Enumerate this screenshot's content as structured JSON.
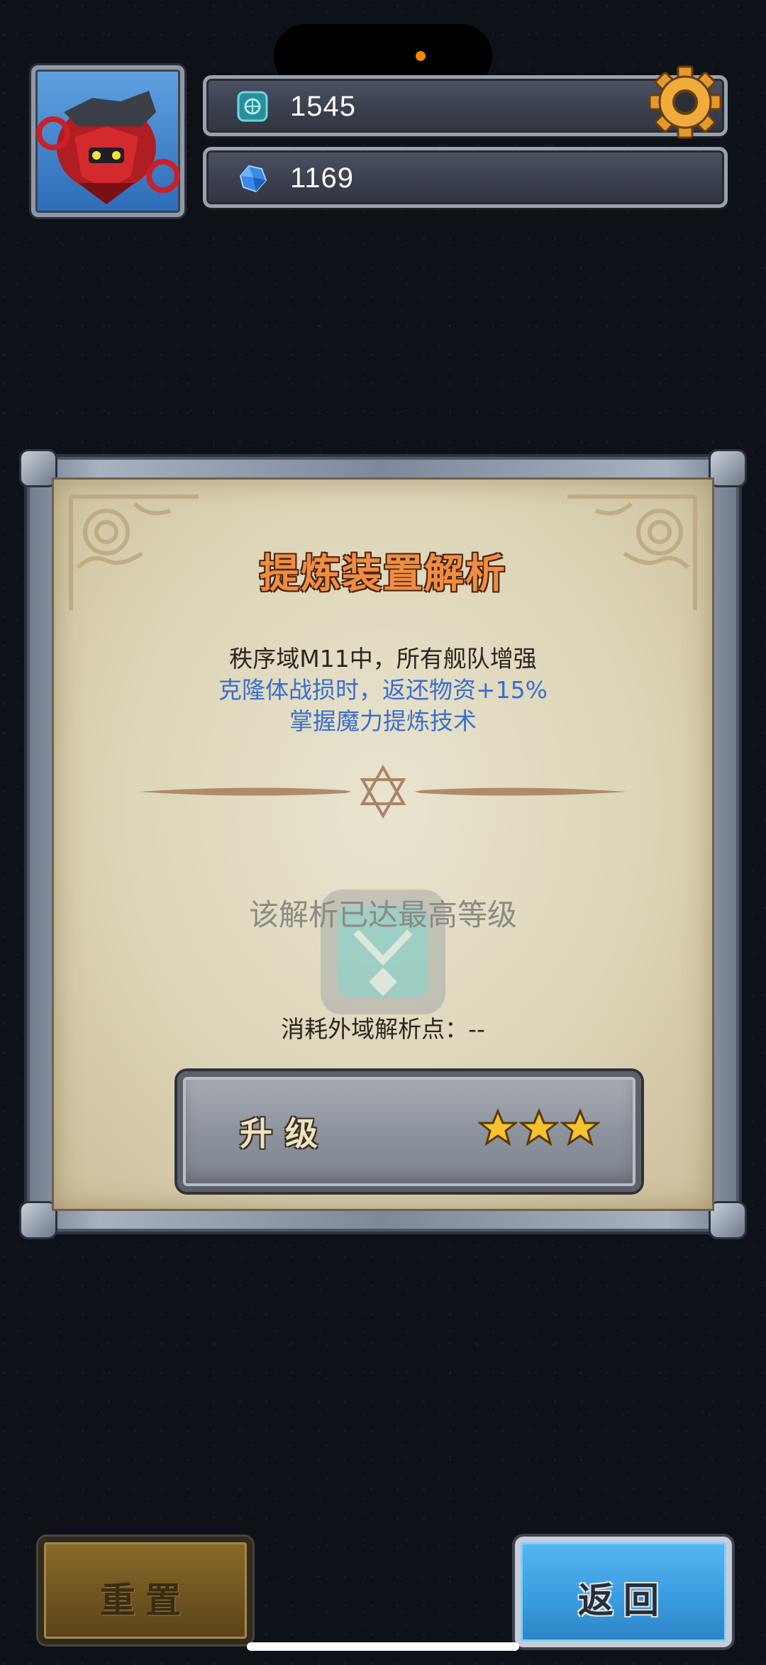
{
  "header": {
    "resources": [
      {
        "icon": "chip-icon",
        "value": "1545"
      },
      {
        "icon": "blue-crystal-icon",
        "value": "1169"
      }
    ],
    "avatar_icon": "red-mech-avatar-icon",
    "settings_icon": "gear-icon"
  },
  "dialog": {
    "title": "提炼装置解析",
    "description": [
      "秩序域M11中，所有舰队增强",
      "克隆体战损时，返还物资+15%",
      "掌握魔力提炼技术"
    ],
    "maxed_text": "该解析已达最高等级",
    "cost_text": "消耗外域解析点：--",
    "upgrade_label": "升级",
    "star_count": 3
  },
  "footer": {
    "reset_label": "重置",
    "back_label": "返回"
  },
  "colors": {
    "title": "#ee8e43",
    "highlight_text": "#3a6fd0",
    "back_button": "#3a9de0",
    "reset_button": "#6d531f"
  }
}
